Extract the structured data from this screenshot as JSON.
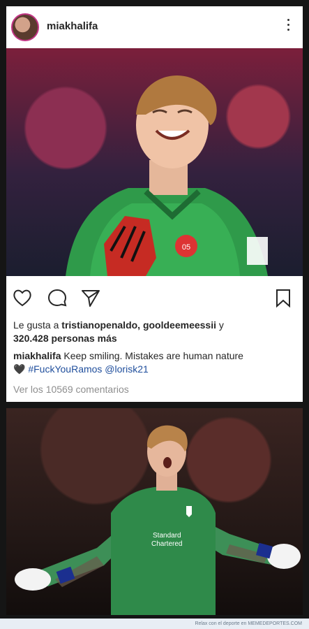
{
  "post": {
    "username": "miakhalifa",
    "likes_prefix": "Le gusta a ",
    "likers": "tristianopenaldo, gooldeemeessii",
    "likes_conj": " y",
    "likes_count": "320.428 personas más",
    "caption_user": "miakhalifa",
    "caption_text": " Keep smiling. Mistakes are human nature",
    "caption_tags": "#FuckYouRamos @lorisk21",
    "comments_link": "Ver los 10569 comentarios"
  },
  "footer": {
    "text": "Relax con el deporte en MEMEDEPORTES.COM"
  },
  "icons": {
    "like": "heart-icon",
    "comment": "comment-icon",
    "share": "share-icon",
    "save": "bookmark-icon",
    "more": "more-vert-icon",
    "emoji": "black-heart-icon"
  }
}
